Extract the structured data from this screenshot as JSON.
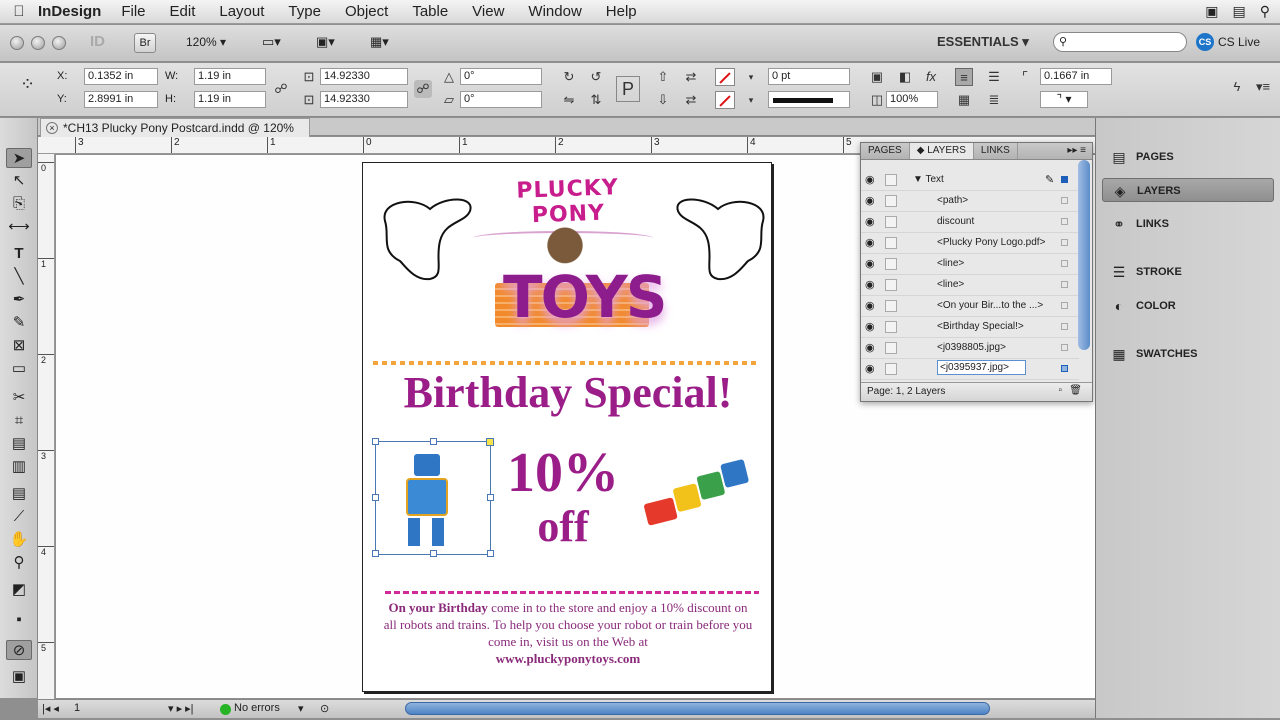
{
  "menubar": {
    "app": "InDesign",
    "items": [
      "File",
      "Edit",
      "Layout",
      "Type",
      "Object",
      "Table",
      "View",
      "Window",
      "Help"
    ]
  },
  "appbar": {
    "bridge": "Br",
    "zoom": "120%",
    "workspace": "ESSENTIALS",
    "cslive": "CS Live",
    "search_placeholder": ""
  },
  "control": {
    "x_label": "X:",
    "x": "0.1352 in",
    "y_label": "Y:",
    "y": "2.8991 in",
    "w_label": "W:",
    "w": "1.19 in",
    "h_label": "H:",
    "h": "1.19 in",
    "scale_x": "14.92330",
    "scale_y": "14.92330",
    "angle": "0°",
    "shear": "0°",
    "stroke_weight": "0 pt",
    "opacity": "100%",
    "corner": "0.1667 in"
  },
  "document": {
    "tab_title": "*CH13 Plucky Pony Postcard.indd @ 120%"
  },
  "ruler": {
    "h": [
      "3",
      "2",
      "1",
      "0",
      "1",
      "2",
      "3",
      "4",
      "5"
    ],
    "v": [
      "0",
      "1",
      "2",
      "3",
      "4",
      "5"
    ]
  },
  "layers_panel": {
    "tabs": [
      "PAGES",
      "LAYERS",
      "LINKS"
    ],
    "layer_name": "Text",
    "items": [
      "<path>",
      "discount",
      "<Plucky Pony Logo.pdf>",
      "<line>",
      "<line>",
      "<On your Bir...to the ...>",
      "<Birthday Special!>",
      "<j0398805.jpg>",
      "<j0395937.jpg>"
    ],
    "selected_item": "<j0395937.jpg>",
    "footer": "Page: 1, 2 Layers"
  },
  "dock": {
    "items": [
      "PAGES",
      "LAYERS",
      "LINKS",
      "STROKE",
      "COLOR",
      "SWATCHES"
    ],
    "active": "LAYERS"
  },
  "status": {
    "page": "1",
    "preflight": "No errors"
  },
  "artwork": {
    "brand_arc": "PLUCKY PONY",
    "brand_toys": "TOYS",
    "headline": "Birthday Special!",
    "discount_big": "10%",
    "discount_off": "off",
    "body_lead": "On your Birthday",
    "body_rest": " come in to the store and enjoy a 10% discount on all robots and trains. To help you choose your robot or train before you come in, visit us on the Web at",
    "url": "www.pluckyponytoys.com"
  },
  "colors": {
    "magenta": "#c81d8c",
    "purple": "#9a1d88",
    "orange": "#f28a2c",
    "selection": "#4a78b5"
  }
}
